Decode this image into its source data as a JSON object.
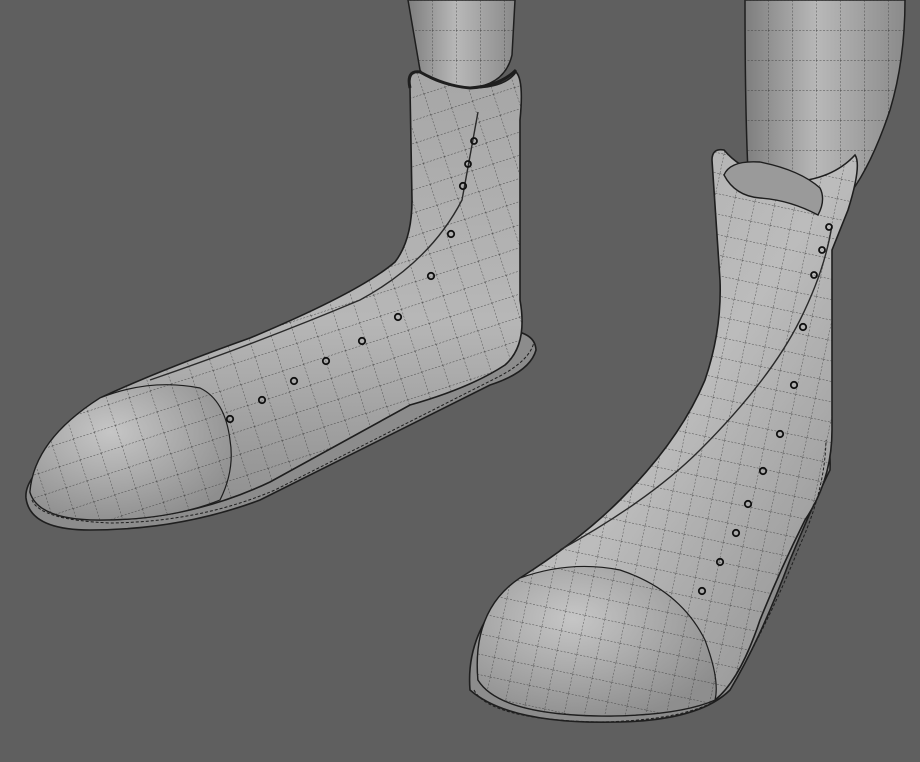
{
  "viewport": {
    "background_color": "#5f5f5f",
    "mesh_fill_light": "#b9b9b9",
    "mesh_fill_mid": "#9c9c9c",
    "mesh_fill_dark": "#7a7a7a",
    "wire_color": "#2a2a2a",
    "outline_color": "#1e1e1e"
  },
  "scene": {
    "objects": [
      "left-boot",
      "right-boot",
      "left-leg",
      "right-leg"
    ],
    "eyelets_per_boot": 11
  }
}
